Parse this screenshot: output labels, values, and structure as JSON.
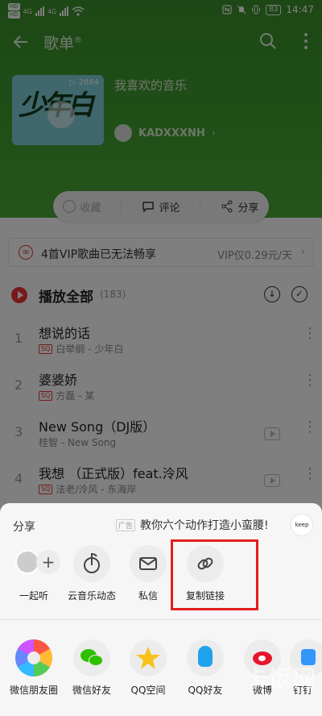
{
  "status_bar": {
    "time": "14:47",
    "battery": "83",
    "signal1": "4G",
    "signal2": "4G"
  },
  "header": {
    "title": "歌单"
  },
  "playlist": {
    "name": "我喜欢的音乐",
    "creator": "KADXXXNH",
    "play_count": "2884",
    "cover_text": "少年白"
  },
  "actions": {
    "collect": "收藏",
    "comment": "评论",
    "share": "分享"
  },
  "vip_notice": {
    "message": "4首VIP歌曲已无法畅享",
    "price": "VIP仅0.29元/天"
  },
  "play_all": {
    "label": "播放全部",
    "count": "(183)"
  },
  "songs": [
    {
      "index": "1",
      "title": "想说的话",
      "artist": "白举纲 - 少年白",
      "sq": "SQ"
    },
    {
      "index": "2",
      "title": "婆婆娇",
      "artist": "方磊 - 某",
      "sq": "SQ"
    },
    {
      "index": "3",
      "title": "New Song（DJ版）",
      "artist": "桂智 - New Song",
      "sq": ""
    },
    {
      "index": "4",
      "title": "我想 （正式版）feat.泠风",
      "artist": "法老/泠风 - 东海岸",
      "sq": "SQ"
    }
  ],
  "share_sheet": {
    "title": "分享",
    "ad_tag": "广告",
    "ad_text": "教你六个动作打造小蛮腰!",
    "ad_brand": "keep",
    "row1": [
      {
        "label": "一起听",
        "icon": "listen-together-icon"
      },
      {
        "label": "云音乐动态",
        "icon": "cloud-music-feed-icon"
      },
      {
        "label": "私信",
        "icon": "mail-icon"
      },
      {
        "label": "复制链接",
        "icon": "link-icon"
      }
    ],
    "row2": [
      {
        "label": "微信朋友圈",
        "icon": "wechat-moments-icon"
      },
      {
        "label": "微信好友",
        "icon": "wechat-icon"
      },
      {
        "label": "QQ空间",
        "icon": "qzone-icon"
      },
      {
        "label": "QQ好友",
        "icon": "qq-icon"
      },
      {
        "label": "微博",
        "icon": "weibo-icon"
      },
      {
        "label": "钉钉",
        "icon": "dingtalk-icon"
      }
    ]
  },
  "watermark": "卡饭网",
  "colors": {
    "accent_red": "#e51d1d",
    "header_green": "#3f9d2f"
  }
}
